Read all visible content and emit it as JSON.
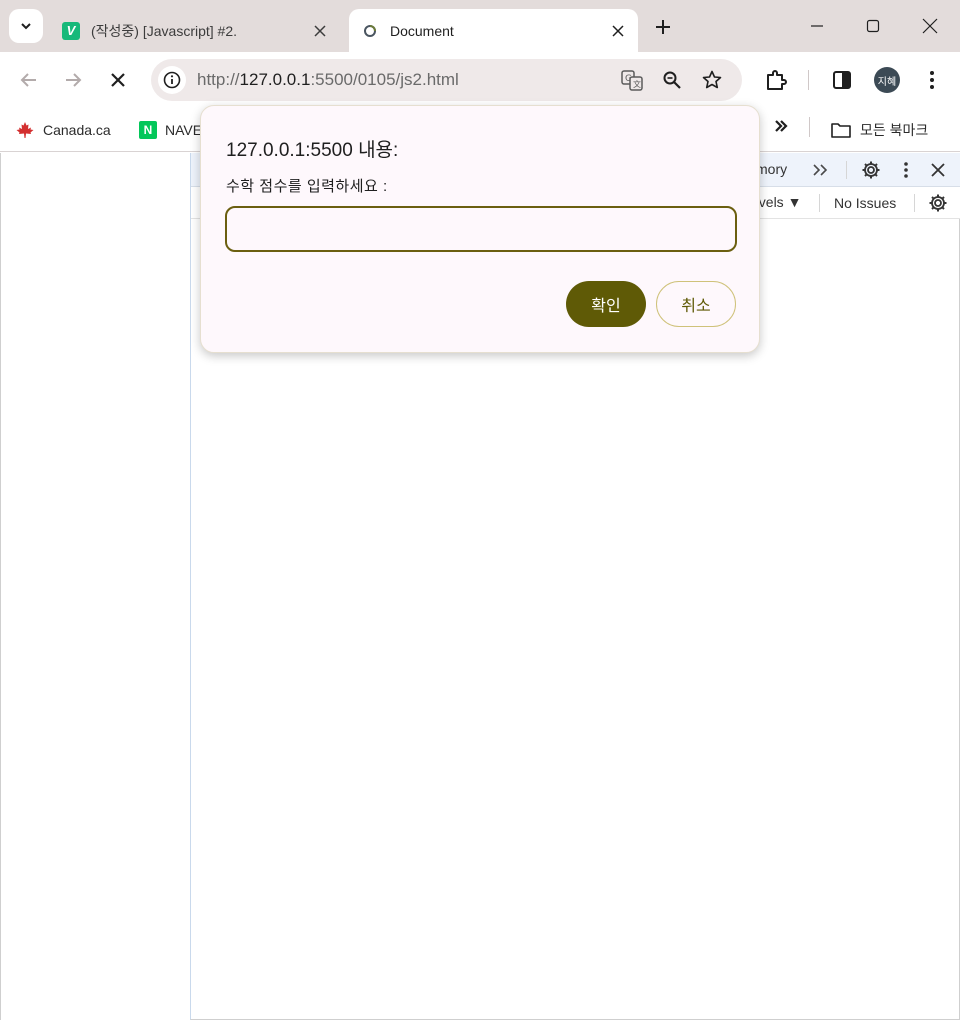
{
  "browser": {
    "tabs": [
      {
        "title": "(작성중) [Javascript] #2.",
        "favicon": "V"
      },
      {
        "title": "Document"
      }
    ],
    "url": {
      "scheme": "http://",
      "host": "127.0.0.1",
      "rest": ":5500/0105/js2.html"
    },
    "avatar_label": "지혜"
  },
  "bookmarks": {
    "items": [
      {
        "label": "Canada.ca",
        "icon": "maple-leaf"
      },
      {
        "label": "NAVE",
        "icon": "N"
      }
    ],
    "all_bookmarks": "모든 북마크"
  },
  "devtools": {
    "tab_partial": "mory",
    "levels_label": "evels",
    "issues_label": "No Issues"
  },
  "dialog": {
    "title": "127.0.0.1:5500 내용:",
    "message": "수학 점수를 입력하세요 :",
    "input_value": "",
    "ok_label": "확인",
    "cancel_label": "취소"
  },
  "colors": {
    "accent": "#5f5a06",
    "dialog_bg": "#fef8fc",
    "titlebar_bg": "#e3dcdb"
  }
}
